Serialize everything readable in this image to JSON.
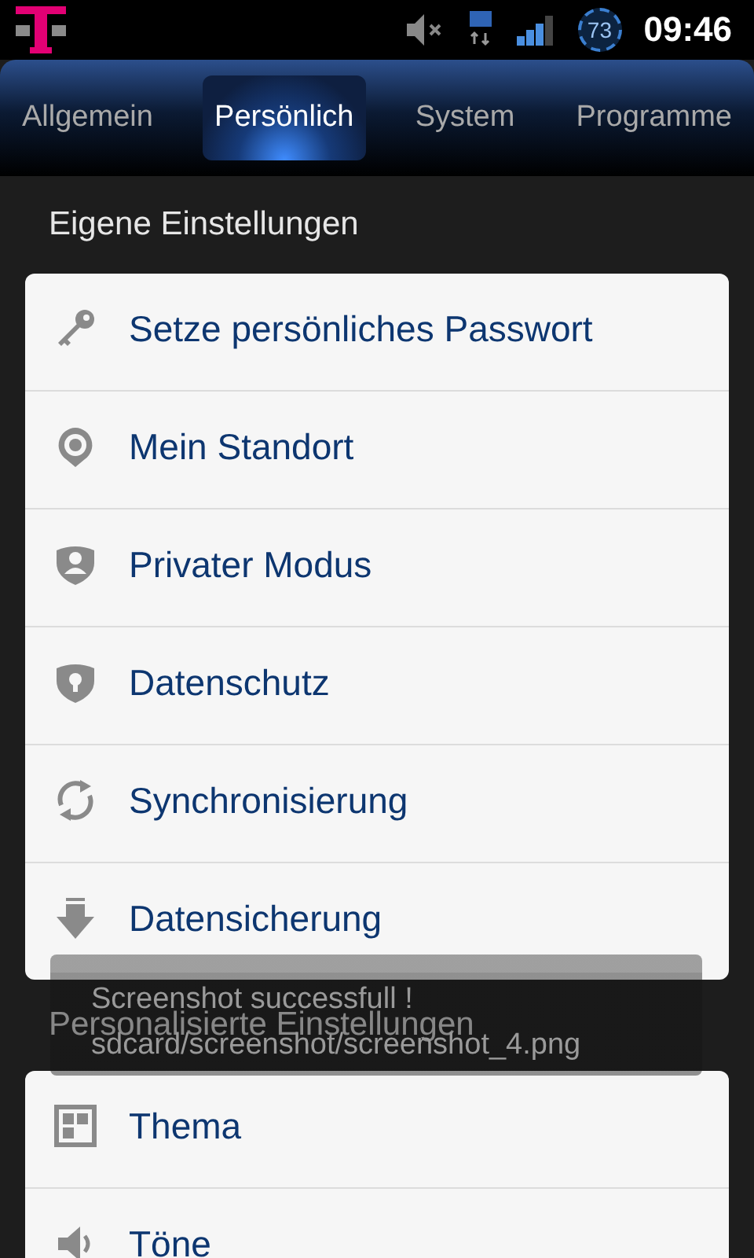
{
  "status_bar": {
    "battery": "73",
    "time": "09:46"
  },
  "tabs": [
    {
      "label": "Allgemein",
      "selected": false
    },
    {
      "label": "Persönlich",
      "selected": true
    },
    {
      "label": "System",
      "selected": false
    },
    {
      "label": "Programme",
      "selected": false
    }
  ],
  "sections": [
    {
      "title": "Eigene Einstellungen",
      "items": [
        {
          "label": "Setze persönliches Passwort"
        },
        {
          "label": "Mein Standort"
        },
        {
          "label": "Privater Modus"
        },
        {
          "label": "Datenschutz"
        },
        {
          "label": "Synchronisierung"
        },
        {
          "label": "Datensicherung"
        }
      ]
    },
    {
      "title": "Personalisierte Einstellungen",
      "items": [
        {
          "label": "Thema"
        },
        {
          "label": "Töne"
        }
      ]
    }
  ],
  "toast": {
    "lines": [
      "Screenshot successfull  !",
      "sdcard/screenshot/screenshot_4.png"
    ]
  }
}
